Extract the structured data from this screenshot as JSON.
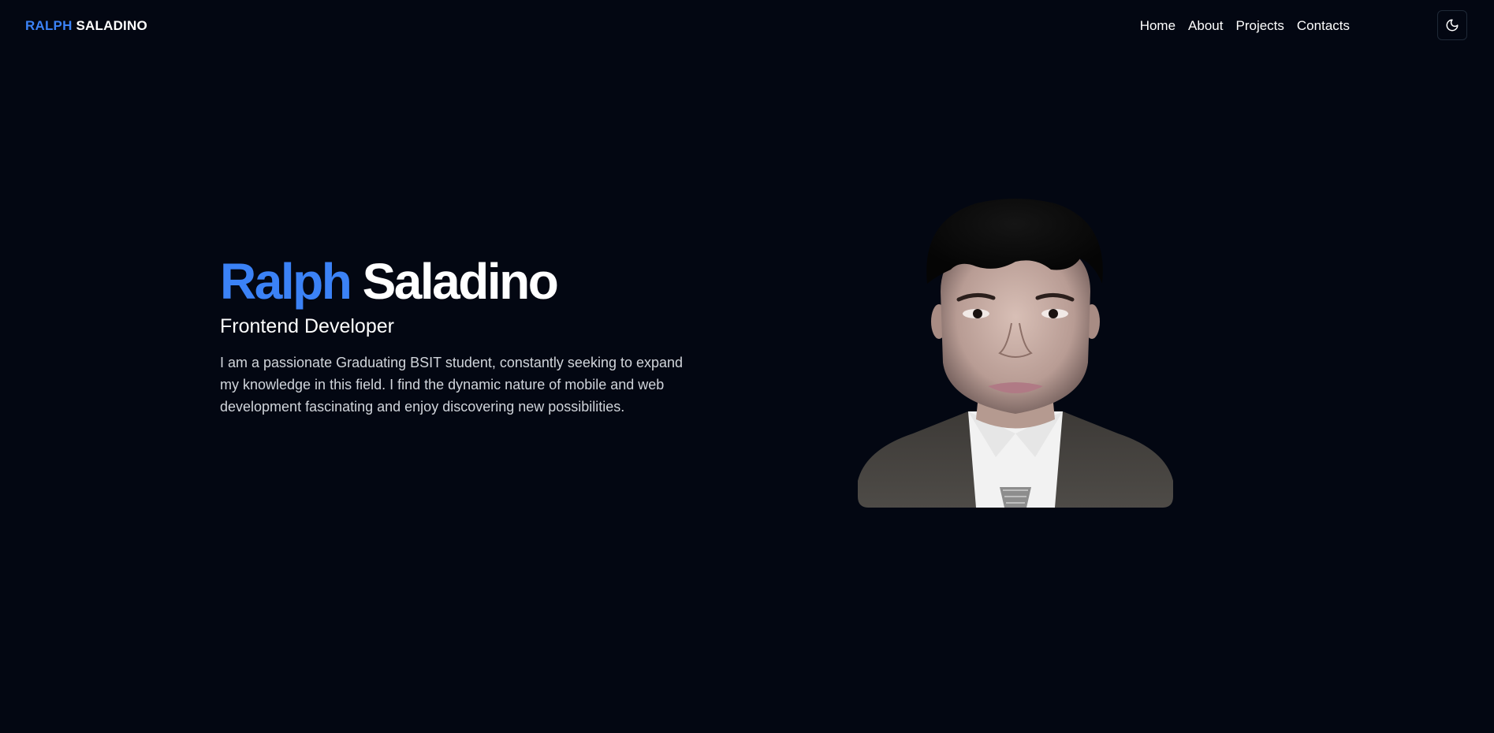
{
  "header": {
    "logo_first": "RALPH",
    "logo_last": "SALADINO",
    "nav": [
      "Home",
      "About",
      "Projects",
      "Contacts"
    ],
    "theme_toggle_icon": "moon-icon"
  },
  "hero": {
    "name_first": "Ralph",
    "name_last": "Saladino",
    "role": "Frontend Developer",
    "description": "I am a passionate Graduating BSIT student, constantly seeking to expand my knowledge in this field. I find the dynamic nature of mobile and web development fascinating and enjoy discovering new possibilities.",
    "portrait_icon": "profile-photo"
  },
  "colors": {
    "background": "#030712",
    "accent": "#3b82f6",
    "text": "#ffffff",
    "muted_text": "#d1d5db"
  }
}
